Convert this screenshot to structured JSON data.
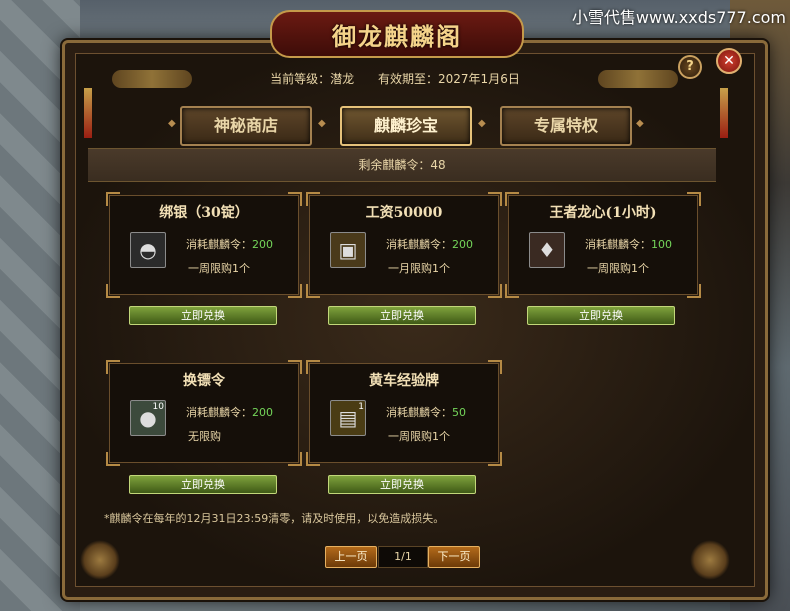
{
  "watermark": "小雪代售www.xxds777.com",
  "window": {
    "title": "御龙麒麟阁"
  },
  "header": {
    "level_label": "当前等级：潜龙",
    "expiry_label": "有效期至：2027年1月6日"
  },
  "tabs": [
    {
      "label": "神秘商店",
      "active": false
    },
    {
      "label": "麒麟珍宝",
      "active": true
    },
    {
      "label": "专属特权",
      "active": false
    }
  ],
  "remaining": "剩余麒麟令：48",
  "items": [
    {
      "title": "绑银（30锭）",
      "cost_label": "消耗麒麟令：",
      "cost": "200",
      "limit": "一周限购1个",
      "icon": "silver-ingot-icon",
      "qty": "",
      "button": "立即兑换"
    },
    {
      "title": "工资50000",
      "cost_label": "消耗麒麟令：",
      "cost": "200",
      "limit": "一月限购1个",
      "icon": "gold-ingot-icon",
      "qty": "",
      "button": "立即兑换"
    },
    {
      "title": "王者龙心(1小时)",
      "cost_label": "消耗麒麟令：",
      "cost": "100",
      "limit": "一周限购1个",
      "icon": "dragon-heart-icon",
      "qty": "",
      "button": "立即兑换"
    },
    {
      "title": "换镖令",
      "cost_label": "消耗麒麟令：",
      "cost": "200",
      "limit": "无限购",
      "icon": "escort-token-icon",
      "qty": "10",
      "button": "立即兑换"
    },
    {
      "title": "黄车经验牌",
      "cost_label": "消耗麒麟令：",
      "cost": "50",
      "limit": "一周限购1个",
      "icon": "gold-cart-icon",
      "qty": "1",
      "button": "立即兑换"
    }
  ],
  "footnote": "*麒麟令在每年的12月31日23:59清零，请及时使用，以免造成损失。",
  "pager": {
    "prev": "上一页",
    "page": "1/1",
    "next": "下一页"
  },
  "colors": {
    "accent_gold": "#e6c27a",
    "cost_green": "#74d55a",
    "button_green": "#7fa23c",
    "pager_orange": "#b36a1a"
  }
}
